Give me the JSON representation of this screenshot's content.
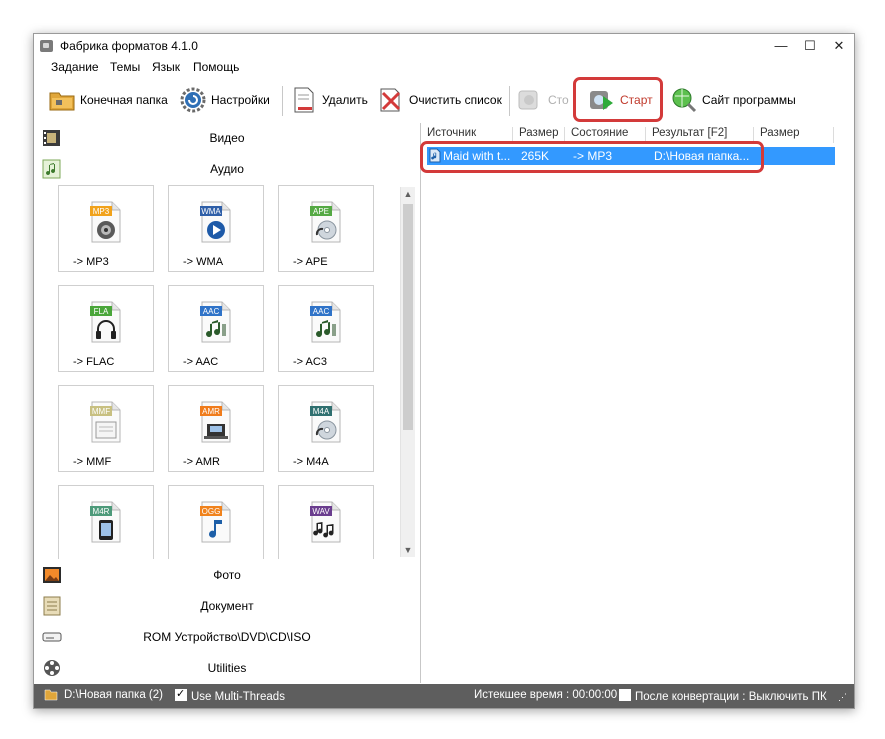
{
  "window": {
    "title": "Фабрика форматов 4.1.0",
    "minimize": "—",
    "maximize": "☐",
    "close": "✕"
  },
  "menu": [
    "Задание",
    "Темы",
    "Язык",
    "Помощь"
  ],
  "toolbar": {
    "dest_folder": "Конечная папка",
    "settings": "Настройки",
    "delete": "Удалить",
    "clear_list": "Очистить список",
    "stop": "Сто",
    "start": "Старт",
    "website": "Сайт программы"
  },
  "categories": {
    "video": "Видео",
    "audio": "Аудио",
    "photo": "Фото",
    "document": "Документ",
    "rom": "ROM Устройство\\DVD\\CD\\ISO",
    "utilities": "Utilities"
  },
  "audio_formats": [
    {
      "badge": "MP3",
      "label": "-> MP3",
      "color": "#f1a21b",
      "icon": "speaker-icon"
    },
    {
      "badge": "WMA",
      "label": "-> WMA",
      "color": "#2f5fa8",
      "icon": "play-icon"
    },
    {
      "badge": "APE",
      "label": "-> APE",
      "color": "#55a944",
      "icon": "cd-icon"
    },
    {
      "badge": "FLA",
      "label": "-> FLAC",
      "color": "#4aa63a",
      "icon": "headphones-icon"
    },
    {
      "badge": "AAC",
      "label": "-> AAC",
      "color": "#2f73c8",
      "icon": "music-icon"
    },
    {
      "badge": "AAC",
      "label": "-> AC3",
      "color": "#2f73c8",
      "icon": "music-icon"
    },
    {
      "badge": "MMF",
      "label": "-> MMF",
      "color": "#c8c081",
      "icon": "doc-icon"
    },
    {
      "badge": "AMR",
      "label": "-> AMR",
      "color": "#f07c1c",
      "icon": "amr-icon"
    },
    {
      "badge": "M4A",
      "label": "-> M4A",
      "color": "#2f6f6f",
      "icon": "cd-icon"
    },
    {
      "badge": "M4R",
      "label": "",
      "color": "#4d9a7a",
      "icon": "phone-icon"
    },
    {
      "badge": "OGG",
      "label": "",
      "color": "#f0821c",
      "icon": "note-icon"
    },
    {
      "badge": "WAV",
      "label": "",
      "color": "#6a3d8e",
      "icon": "notes-icon"
    }
  ],
  "table": {
    "columns": [
      "Источник",
      "Размер",
      "Состояние",
      "Результат [F2]",
      "Размер"
    ],
    "rows": [
      {
        "source": "Maid with t...",
        "size": "265K",
        "status": "-> MP3",
        "result": "D:\\Новая папка...",
        "out_size": ""
      }
    ]
  },
  "status": {
    "folder": "D:\\Новая папка (2)",
    "multithreads": "Use Multi-Threads",
    "elapsed": "Истекшее время : 00:00:00",
    "after": "После конвертации : Выключить ПК"
  },
  "colors": {
    "highlight": "#d33a3a",
    "selection": "#3399ff",
    "statusbar": "#5e5e5e"
  }
}
